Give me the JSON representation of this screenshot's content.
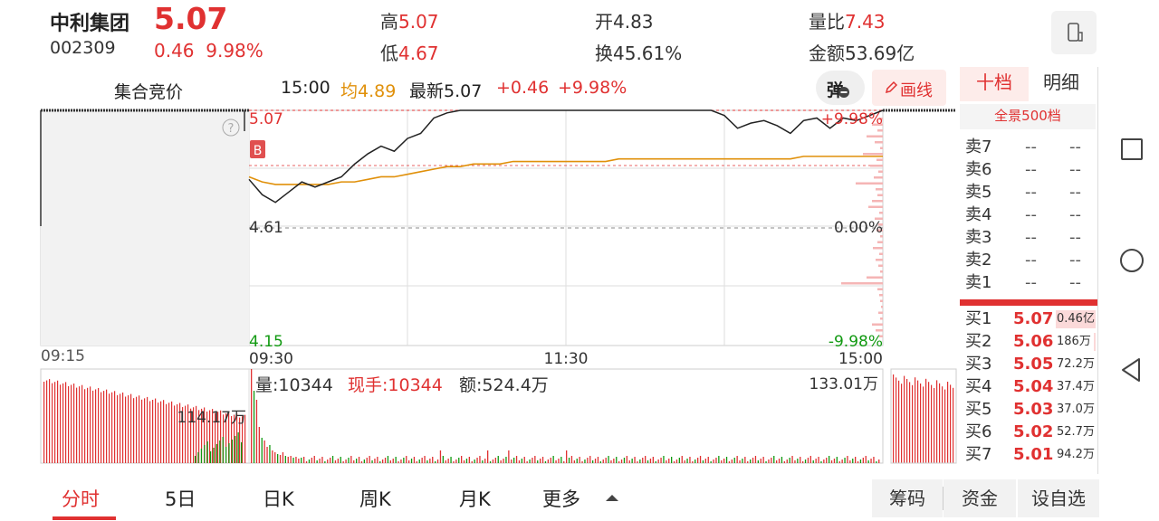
{
  "header": {
    "name": "中利集团",
    "price": "5.07",
    "code": "002309",
    "change": "0.46",
    "change_pct": "9.98%",
    "high_label": "高",
    "high": "5.07",
    "low_label": "低",
    "low": "4.67",
    "open_label": "开",
    "open": "4.83",
    "turnover_label": "换",
    "turnover": "45.61%",
    "vol_ratio_label": "量比",
    "vol_ratio": "7.43",
    "amount_label": "金额",
    "amount": "53.69亿"
  },
  "infobar": {
    "auction_label": "集合竞价",
    "time": "15:00",
    "avg": "均4.89",
    "last": "最新5.07",
    "change": "+0.46",
    "change_pct": "+9.98%",
    "popup_label": "弹",
    "draw_label": "画线"
  },
  "chart_labels": {
    "price_high": "5.07",
    "price_mid": "4.61",
    "price_low": "4.15",
    "pct_high": "+9.98%",
    "pct_mid": "0.00%",
    "pct_low": "-9.98%",
    "buy_marker": "B",
    "help": "?",
    "time_0915": "09:15",
    "time_0930": "09:30",
    "time_1130": "11:30",
    "time_1500": "15:00",
    "vol_label": "量:10344",
    "hand_label": "现手:10344",
    "amt_label": "额:524.4万",
    "vol_max": "133.01万",
    "auction_vol": "114.17万"
  },
  "chart_data": {
    "type": "line",
    "x": [
      "09:30",
      "09:35",
      "09:40",
      "09:45",
      "09:50",
      "09:55",
      "10:00",
      "10:05",
      "10:10",
      "10:15",
      "10:20",
      "10:25",
      "10:30",
      "10:35",
      "10:40",
      "10:45",
      "10:50",
      "10:55",
      "11:00",
      "11:05",
      "11:10",
      "11:15",
      "11:20",
      "11:25",
      "11:30",
      "13:05",
      "13:10",
      "13:15",
      "13:20",
      "13:25",
      "13:30",
      "13:35",
      "13:40",
      "13:45",
      "13:50",
      "13:55",
      "14:00",
      "14:05",
      "14:10",
      "14:15",
      "14:20",
      "14:25",
      "14:30",
      "14:35",
      "14:40",
      "14:45",
      "14:50",
      "14:55",
      "15:00"
    ],
    "series": [
      {
        "name": "",
        "values": [
          4.8,
          4.74,
          4.71,
          4.75,
          4.79,
          4.77,
          4.79,
          4.81,
          4.86,
          4.9,
          4.93,
          4.91,
          4.96,
          4.98,
          5.04,
          5.06,
          5.07,
          5.07,
          5.07,
          5.07,
          5.07,
          5.07,
          5.07,
          5.07,
          5.07,
          5.07,
          5.07,
          5.07,
          5.07,
          5.07,
          5.07,
          5.07,
          5.07,
          5.07,
          5.07,
          5.07,
          5.05,
          5.0,
          5.02,
          5.03,
          5.01,
          4.98,
          5.03,
          5.04,
          5.0,
          5.04,
          5.03,
          5.05,
          5.07
        ]
      },
      {
        "name": "均",
        "values": [
          4.81,
          4.79,
          4.78,
          4.78,
          4.78,
          4.78,
          4.78,
          4.79,
          4.79,
          4.8,
          4.81,
          4.81,
          4.82,
          4.83,
          4.84,
          4.85,
          4.85,
          4.86,
          4.86,
          4.86,
          4.87,
          4.87,
          4.87,
          4.87,
          4.87,
          4.87,
          4.87,
          4.87,
          4.88,
          4.88,
          4.88,
          4.88,
          4.88,
          4.88,
          4.88,
          4.88,
          4.88,
          4.88,
          4.88,
          4.88,
          4.88,
          4.88,
          4.89,
          4.89,
          4.89,
          4.89,
          4.89,
          4.89,
          4.89
        ]
      }
    ],
    "ylim": [
      4.15,
      5.07
    ],
    "prev_close": "4.61",
    "grid": true
  },
  "orderbook": {
    "tab_ten": "十档",
    "tab_detail": "明细",
    "full_500": "全景500档",
    "sells": [
      {
        "label": "卖7",
        "price": "--",
        "vol": "--"
      },
      {
        "label": "卖6",
        "price": "--",
        "vol": "--"
      },
      {
        "label": "卖5",
        "price": "--",
        "vol": "--"
      },
      {
        "label": "卖4",
        "price": "--",
        "vol": "--"
      },
      {
        "label": "卖3",
        "price": "--",
        "vol": "--"
      },
      {
        "label": "卖2",
        "price": "--",
        "vol": "--"
      },
      {
        "label": "卖1",
        "price": "--",
        "vol": "--"
      }
    ],
    "buys": [
      {
        "label": "买1",
        "price": "5.07",
        "vol": "0.46亿"
      },
      {
        "label": "买2",
        "price": "5.06",
        "vol": "186万"
      },
      {
        "label": "买3",
        "price": "5.05",
        "vol": "72.2万"
      },
      {
        "label": "买4",
        "price": "5.04",
        "vol": "37.4万"
      },
      {
        "label": "买5",
        "price": "5.03",
        "vol": "37.0万"
      },
      {
        "label": "买6",
        "price": "5.02",
        "vol": "52.7万"
      },
      {
        "label": "买7",
        "price": "5.01",
        "vol": "94.2万"
      }
    ]
  },
  "bottom_tabs": {
    "fenshi": "分时",
    "five_day": "5日",
    "day_k": "日K",
    "week_k": "周K",
    "month_k": "月K",
    "more": "更多",
    "chips": "筹码",
    "funds": "资金",
    "watchlist": "设自选"
  },
  "colors": {
    "up": "#e03131",
    "down": "#119911",
    "avg_line": "#e0900a",
    "price_line": "#222222"
  }
}
